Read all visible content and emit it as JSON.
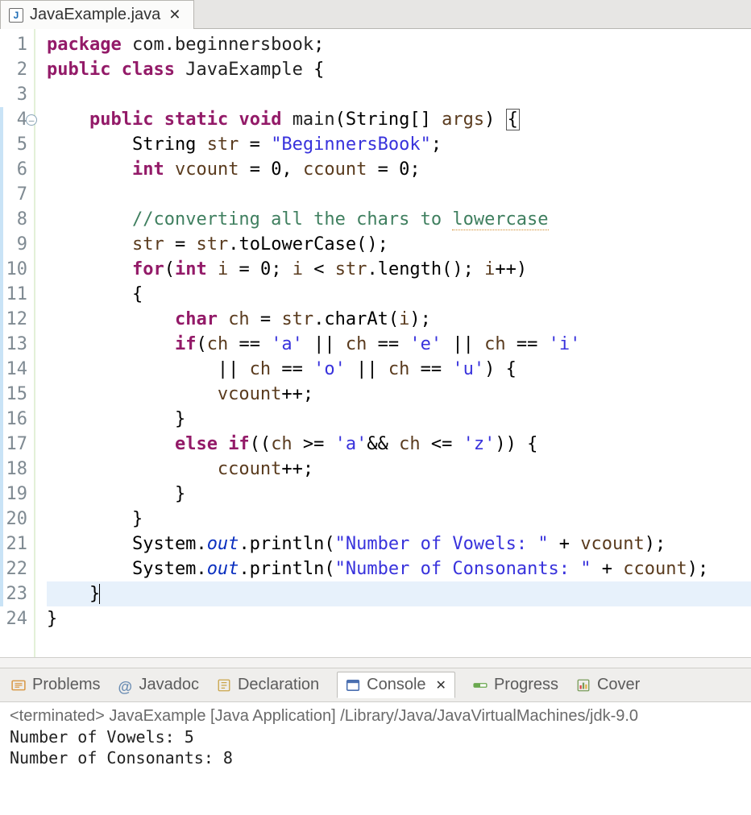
{
  "tab": {
    "filename": "JavaExample.java",
    "icon": "J"
  },
  "editor": {
    "line_count": 24,
    "method_start": 4,
    "method_end": 23,
    "highlighted_line": 23,
    "code_lines": [
      {
        "n": 1,
        "html": "<span class='kw'>package</span> <span class='pkg'>com.beginnersbook</span>;"
      },
      {
        "n": 2,
        "html": "<span class='kw'>public</span> <span class='kw'>class</span> <span class='ident'>JavaExample</span> {"
      },
      {
        "n": 3,
        "html": ""
      },
      {
        "n": 4,
        "html": "    <span class='kw'>public</span> <span class='kw'>static</span> <span class='kw'>void</span> <span class='mname'>main</span>(String[] <span class='vname'>args</span>) <span class='boxb'>{</span>"
      },
      {
        "n": 5,
        "html": "        String <span class='vname'>str</span> = <span class='str'>\"BeginnersBook\"</span>;"
      },
      {
        "n": 6,
        "html": "        <span class='kw'>int</span> <span class='vname'>vcount</span> = 0, <span class='vname'>ccount</span> = 0;"
      },
      {
        "n": 7,
        "html": ""
      },
      {
        "n": 8,
        "html": "        <span class='comm'>//converting all the chars to <span class='spell'>lowercase</span></span>"
      },
      {
        "n": 9,
        "html": "        <span class='vname'>str</span> = <span class='vname'>str</span>.toLowerCase();"
      },
      {
        "n": 10,
        "html": "        <span class='kw'>for</span>(<span class='kw'>int</span> <span class='vname'>i</span> = 0; <span class='vname'>i</span> &lt; <span class='vname'>str</span>.length(); <span class='vname'>i</span>++)"
      },
      {
        "n": 11,
        "html": "        {"
      },
      {
        "n": 12,
        "html": "            <span class='kw'>char</span> <span class='vname'>ch</span> = <span class='vname'>str</span>.charAt(<span class='vname'>i</span>);"
      },
      {
        "n": 13,
        "html": "            <span class='kw'>if</span>(<span class='vname'>ch</span> == <span class='char'>'a'</span> || <span class='vname'>ch</span> == <span class='char'>'e'</span> || <span class='vname'>ch</span> == <span class='char'>'i'</span>"
      },
      {
        "n": 14,
        "html": "                || <span class='vname'>ch</span> == <span class='char'>'o'</span> || <span class='vname'>ch</span> == <span class='char'>'u'</span>) {"
      },
      {
        "n": 15,
        "html": "                <span class='vname'>vcount</span>++;"
      },
      {
        "n": 16,
        "html": "            }"
      },
      {
        "n": 17,
        "html": "            <span class='kw'>else</span> <span class='kw'>if</span>((<span class='vname'>ch</span> &gt;= <span class='char'>'a'</span>&amp;&amp; <span class='vname'>ch</span> &lt;= <span class='char'>'z'</span>)) {"
      },
      {
        "n": 18,
        "html": "                <span class='vname'>ccount</span>++;"
      },
      {
        "n": 19,
        "html": "            }"
      },
      {
        "n": 20,
        "html": "        }"
      },
      {
        "n": 21,
        "html": "        System.<span class='field-static'>out</span>.println(<span class='str'>\"Number of Vowels: \"</span> + <span class='vname'>vcount</span>);"
      },
      {
        "n": 22,
        "html": "        System.<span class='field-static'>out</span>.println(<span class='str'>\"Number of Consonants: \"</span> + <span class='vname'>ccount</span>);"
      },
      {
        "n": 23,
        "html": "    }<span class='caret'></span>"
      },
      {
        "n": 24,
        "html": "}"
      }
    ]
  },
  "views": {
    "tabs": [
      {
        "id": "problems",
        "label": "Problems",
        "active": false
      },
      {
        "id": "javadoc",
        "label": "Javadoc",
        "active": false,
        "prefix": "@"
      },
      {
        "id": "declaration",
        "label": "Declaration",
        "active": false
      },
      {
        "id": "console",
        "label": "Console",
        "active": true
      },
      {
        "id": "progress",
        "label": "Progress",
        "active": false
      },
      {
        "id": "coverage",
        "label": "Cover",
        "active": false
      }
    ]
  },
  "console": {
    "status": "<terminated> JavaExample [Java Application] /Library/Java/JavaVirtualMachines/jdk-9.0",
    "lines": [
      "Number of Vowels: 5",
      "Number of Consonants: 8"
    ]
  }
}
